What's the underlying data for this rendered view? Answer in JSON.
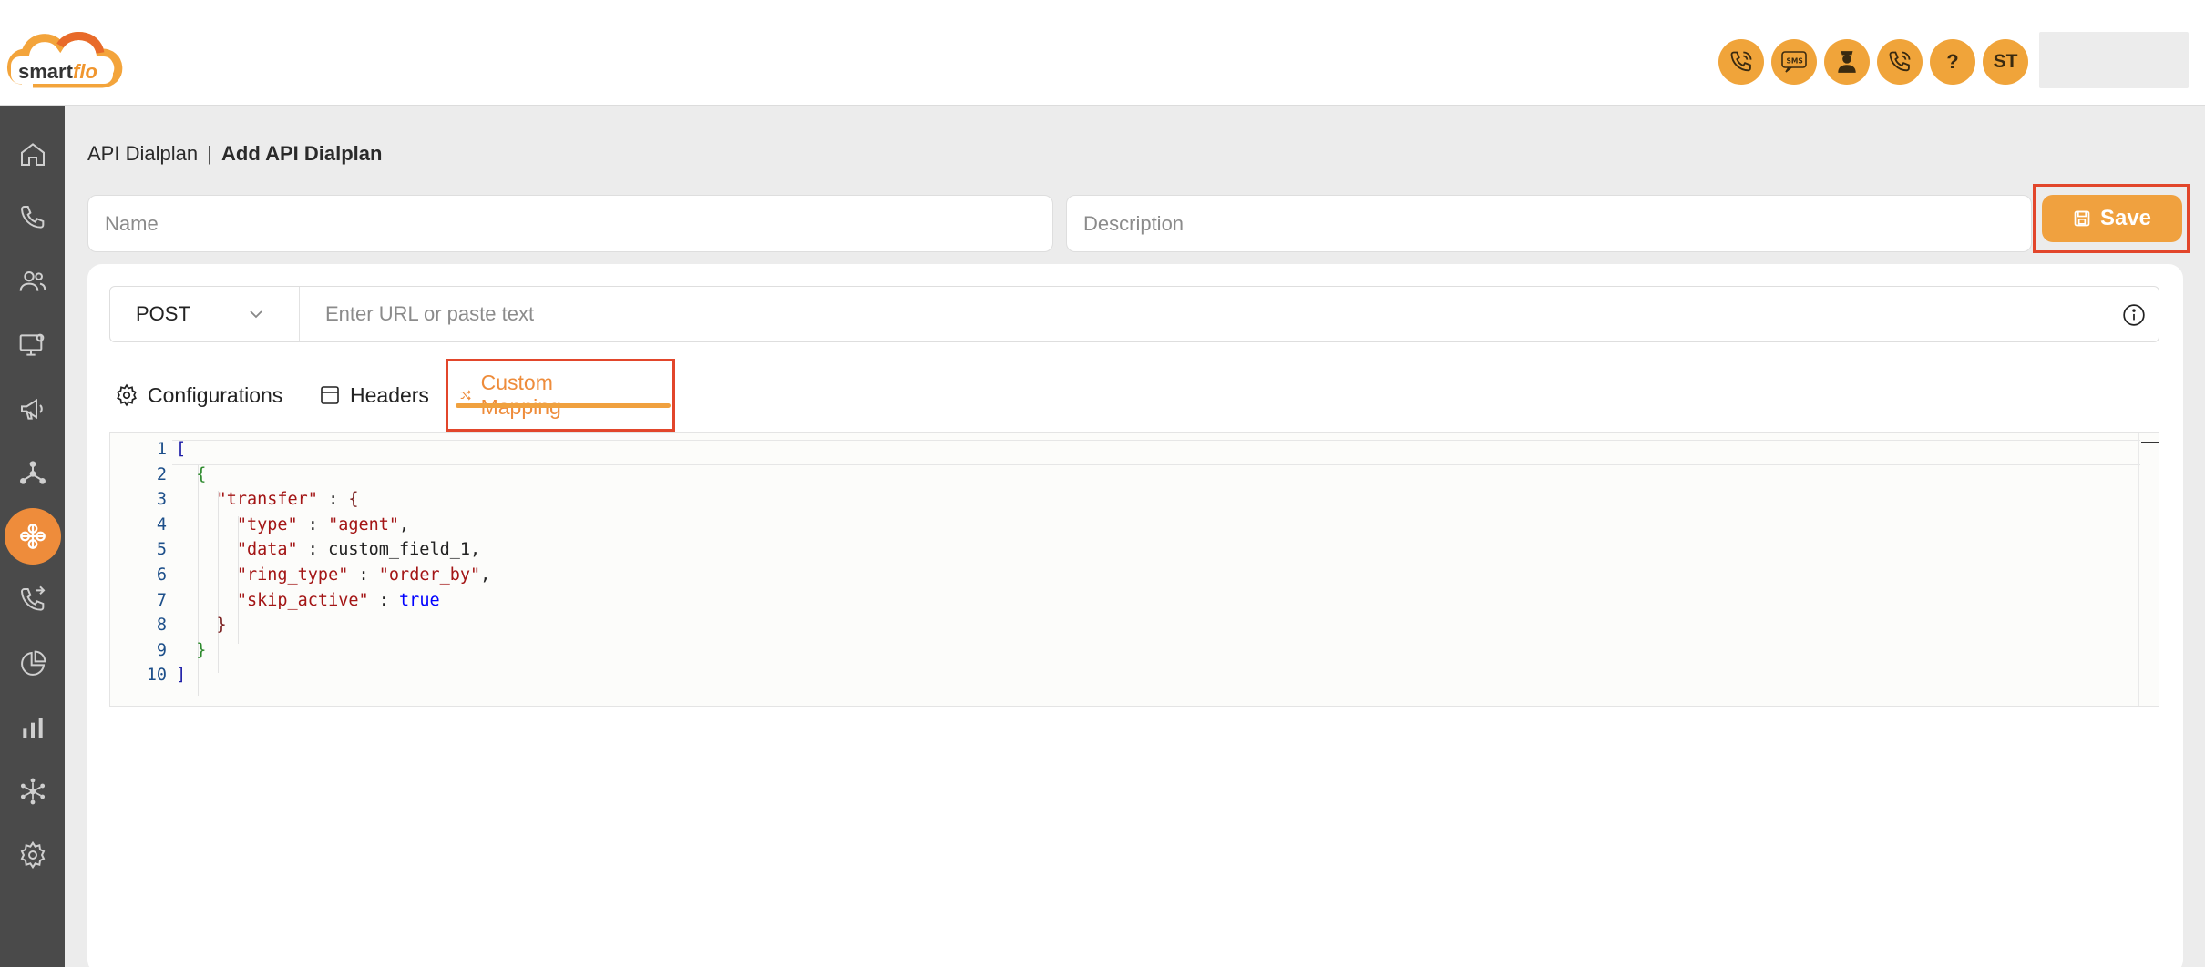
{
  "brand": {
    "logo_text": "smartflo"
  },
  "header": {
    "icons": [
      {
        "name": "call-icon",
        "label": ""
      },
      {
        "name": "sms-icon",
        "label": "SMS"
      },
      {
        "name": "agent-icon",
        "label": ""
      },
      {
        "name": "incoming-call-icon",
        "label": ""
      },
      {
        "name": "help-icon",
        "label": "?"
      },
      {
        "name": "avatar",
        "label": "ST"
      }
    ]
  },
  "sidebar": {
    "items": [
      {
        "name": "home-icon"
      },
      {
        "name": "phone-icon"
      },
      {
        "name": "users-icon"
      },
      {
        "name": "monitor-settings-icon"
      },
      {
        "name": "megaphone-icon"
      },
      {
        "name": "network-icon"
      },
      {
        "name": "api-dialplan-icon",
        "active": true
      },
      {
        "name": "call-routing-icon"
      },
      {
        "name": "pie-chart-icon"
      },
      {
        "name": "bar-chart-icon"
      },
      {
        "name": "integrations-icon"
      },
      {
        "name": "settings-icon"
      }
    ],
    "active_color": "#ee8c3b"
  },
  "breadcrumb": {
    "parent": "API Dialplan",
    "separator": "|",
    "current": "Add API Dialplan"
  },
  "form": {
    "name_placeholder": "Name",
    "description_placeholder": "Description",
    "save_label": "Save"
  },
  "request": {
    "method": "POST",
    "url_placeholder": "Enter URL or paste text"
  },
  "tabs": [
    {
      "label": "Configurations",
      "icon": "gear-icon"
    },
    {
      "label": "Headers",
      "icon": "window-icon"
    },
    {
      "label": "Custom Mapping",
      "icon": "shuffle-icon",
      "active": true
    }
  ],
  "editor": {
    "line_numbers": [
      "1",
      "2",
      "3",
      "4",
      "5",
      "6",
      "7",
      "8",
      "9",
      "10"
    ],
    "lines": [
      {
        "parts": [
          [
            "br",
            "["
          ]
        ]
      },
      {
        "parts": [
          [
            "br2",
            "  {"
          ]
        ]
      },
      {
        "parts": [
          [
            "k",
            "    \"transfer\""
          ],
          [
            "id",
            " : "
          ],
          [
            "br3",
            "{"
          ]
        ]
      },
      {
        "parts": [
          [
            "k",
            "      \"type\""
          ],
          [
            "id",
            " : "
          ],
          [
            "s",
            "\"agent\""
          ],
          [
            "id",
            ","
          ]
        ]
      },
      {
        "parts": [
          [
            "k",
            "      \"data\""
          ],
          [
            "id",
            " : custom_field_1,"
          ]
        ]
      },
      {
        "parts": [
          [
            "k",
            "      \"ring_type\""
          ],
          [
            "id",
            " : "
          ],
          [
            "s",
            "\"order_by\""
          ],
          [
            "id",
            ","
          ]
        ]
      },
      {
        "parts": [
          [
            "k",
            "      \"skip_active\""
          ],
          [
            "id",
            " : "
          ],
          [
            "kw",
            "true"
          ]
        ]
      },
      {
        "parts": [
          [
            "br3",
            "    }"
          ]
        ]
      },
      {
        "parts": [
          [
            "br2",
            "  }"
          ]
        ]
      },
      {
        "parts": [
          [
            "br",
            "]"
          ]
        ]
      }
    ]
  },
  "colors": {
    "accent": "#f0a13f",
    "highlight": "#e2462b",
    "sidebar_bg": "#4a4a4a"
  }
}
